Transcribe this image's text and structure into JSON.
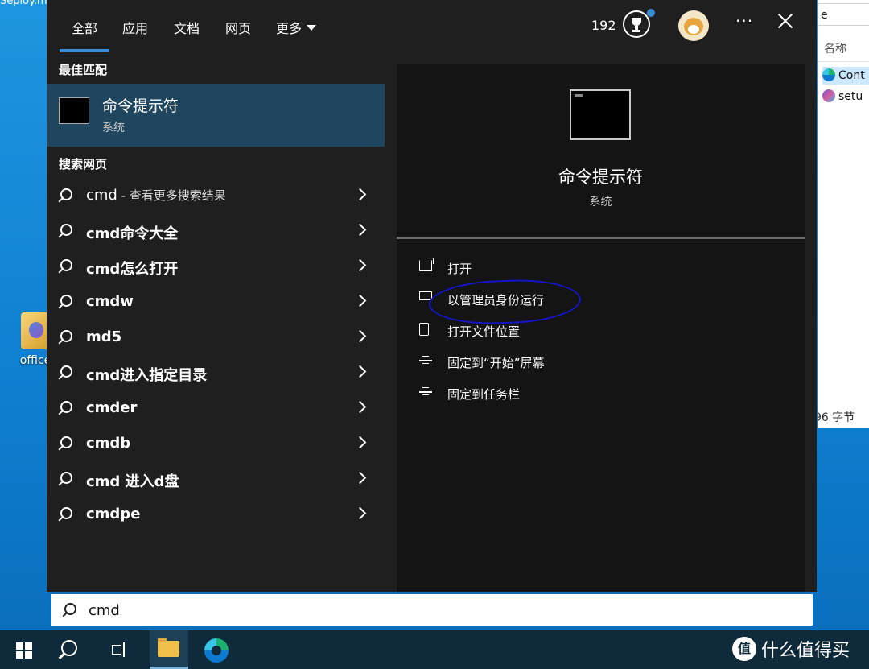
{
  "desktop": {
    "top_text": "Seploy.m...",
    "icon_label": "office"
  },
  "explorer": {
    "address": "e",
    "column": "名称",
    "rows": [
      "Cont",
      "setu"
    ],
    "status": "96 字节"
  },
  "tabs": [
    "全部",
    "应用",
    "文档",
    "网页",
    "更多"
  ],
  "header": {
    "points": "192"
  },
  "best_match": {
    "heading": "最佳匹配",
    "title": "命令提示符",
    "subtitle": "系统"
  },
  "web": {
    "heading": "搜索网页",
    "items": [
      {
        "text": "cmd",
        "hint": " - 查看更多搜索结果"
      },
      {
        "text": "cmd命令大全",
        "hint": ""
      },
      {
        "text": "cmd怎么打开",
        "hint": ""
      },
      {
        "text": "cmdw",
        "hint": ""
      },
      {
        "text": "md5",
        "hint": ""
      },
      {
        "text": "cmd进入指定目录",
        "hint": ""
      },
      {
        "text": "cmder",
        "hint": ""
      },
      {
        "text": "cmdb",
        "hint": ""
      },
      {
        "text": "cmd 进入d盘",
        "hint": ""
      },
      {
        "text": "cmdpe",
        "hint": ""
      }
    ]
  },
  "detail": {
    "title": "命令提示符",
    "subtitle": "系统",
    "actions": [
      "打开",
      "以管理员身份运行",
      "打开文件位置",
      "固定到“开始”屏幕",
      "固定到任务栏"
    ]
  },
  "search": {
    "value": "cmd"
  },
  "taskbar": {
    "watermark_icon": "值",
    "watermark_text": "什么值得买"
  }
}
